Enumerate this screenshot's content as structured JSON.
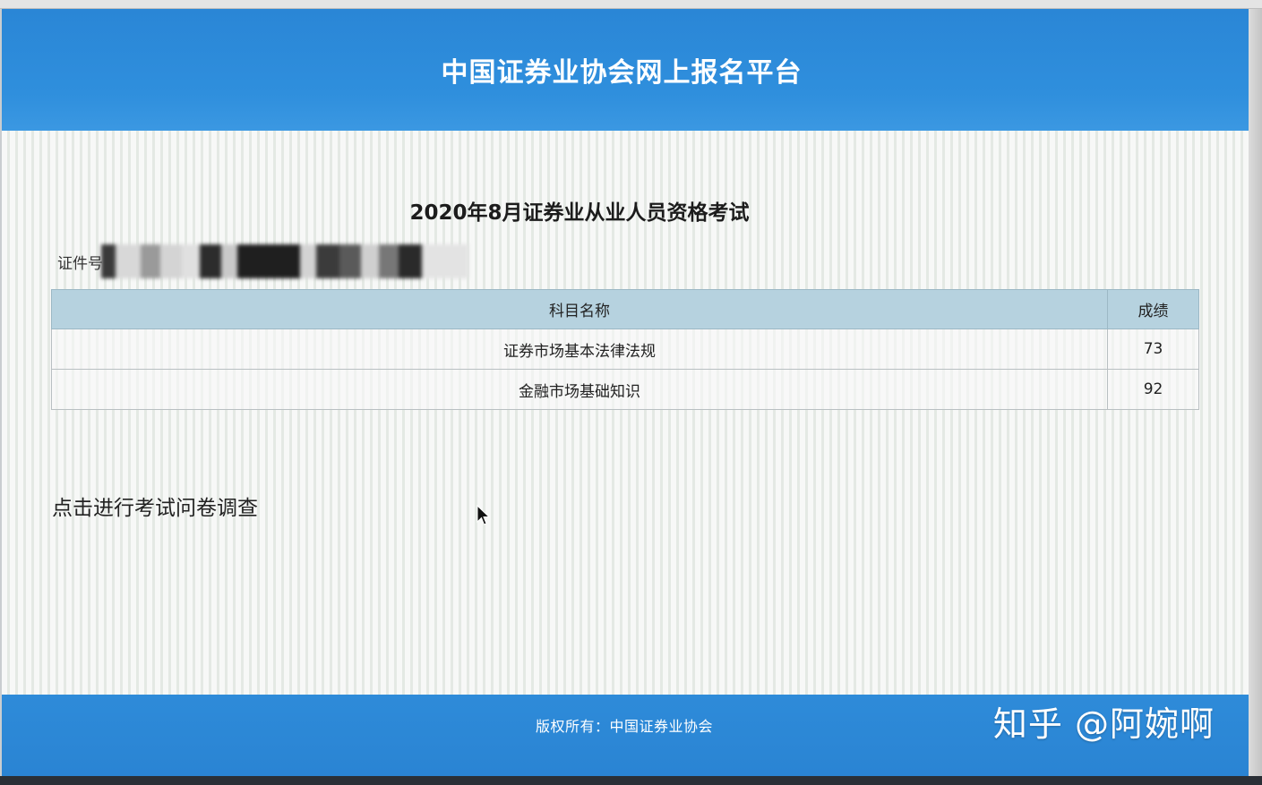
{
  "header": {
    "title": "中国证券业协会网上报名平台"
  },
  "exam": {
    "title": "2020年8月证券业从业人员资格考试",
    "id_label": "证件号"
  },
  "table": {
    "headers": {
      "subject": "科目名称",
      "score": "成绩"
    },
    "rows": [
      {
        "subject": "证券市场基本法律法规",
        "score": "73"
      },
      {
        "subject": "金融市场基础知识",
        "score": "92"
      }
    ]
  },
  "survey": {
    "label": "点击进行考试问卷调查"
  },
  "footer": {
    "copyright": "版权所有：中国证券业协会"
  },
  "watermark": {
    "text": "知乎 @阿婉啊"
  },
  "colors": {
    "header_blue": "#2f8fdd",
    "table_header": "#b6d2df",
    "footer_blue": "#2a84d3"
  },
  "icons": {
    "cursor": "mouse-pointer-icon"
  }
}
